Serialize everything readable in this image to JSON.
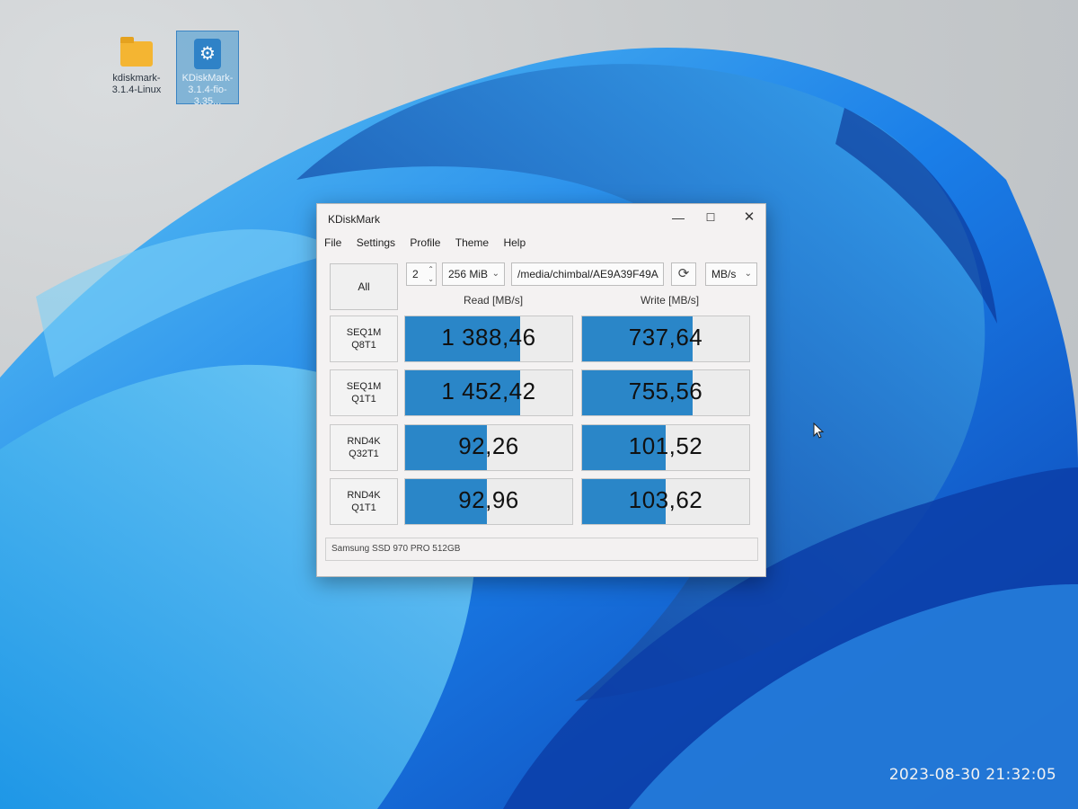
{
  "desktop": {
    "icons": [
      {
        "label": "kdiskmark-3.1.4-Linux",
        "icon": "folder-icon"
      },
      {
        "label": "KDiskMark-3.1.4-fio-3.35...",
        "icon": "app-gear-icon"
      }
    ]
  },
  "window": {
    "title": "KDiskMark",
    "controls": {
      "minimize": "—",
      "maximize": "☐",
      "close": "✕"
    },
    "menu": [
      "File",
      "Settings",
      "Profile",
      "Theme",
      "Help"
    ],
    "toolbar": {
      "all_label": "All",
      "count_value": "2",
      "size_value": "256 MiB",
      "directory_value": "/media/chimbal/AE9A39F49A",
      "unit_value": "MB/s"
    },
    "columns": {
      "read": "Read [MB/s]",
      "write": "Write [MB/s]"
    },
    "rows": [
      {
        "label_line1": "SEQ1M",
        "label_line2": "Q8T1",
        "read": "1 388,46",
        "write": "737,64",
        "read_fill": 0.69,
        "write_fill": 0.66
      },
      {
        "label_line1": "SEQ1M",
        "label_line2": "Q1T1",
        "read": "1 452,42",
        "write": "755,56",
        "read_fill": 0.69,
        "write_fill": 0.66
      },
      {
        "label_line1": "RND4K",
        "label_line2": "Q32T1",
        "read": "92,26",
        "write": "101,52",
        "read_fill": 0.49,
        "write_fill": 0.5
      },
      {
        "label_line1": "RND4K",
        "label_line2": "Q1T1",
        "read": "92,96",
        "write": "103,62",
        "read_fill": 0.49,
        "write_fill": 0.5
      }
    ],
    "device": "Samsung SSD 970 PRO 512GB"
  },
  "timestamp": "2023-08-30 21:32:05",
  "colors": {
    "bar": "#2a86c8",
    "wallpaper_blue": "#1e6fe0"
  }
}
